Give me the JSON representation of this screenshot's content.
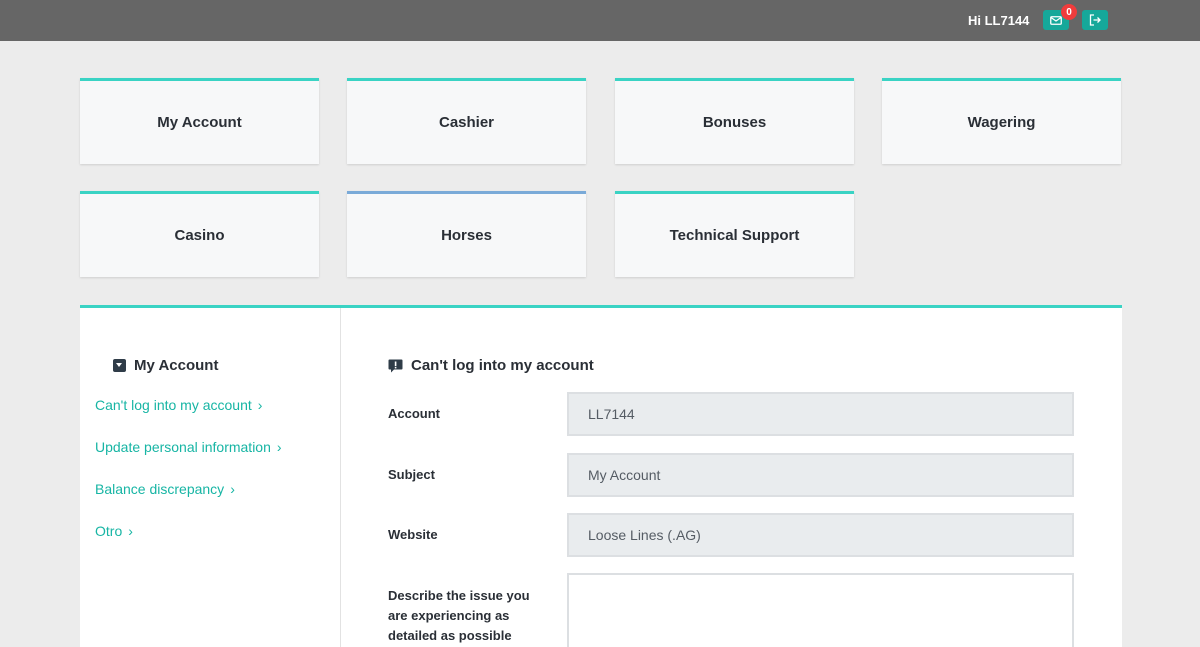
{
  "header": {
    "greeting": "Hi LL7144",
    "mail_badge": "0",
    "mail_icon": "mail-icon",
    "logout_icon": "logout-icon",
    "accent_color": "#16a89a"
  },
  "categories": [
    "My Account",
    "Cashier",
    "Bonuses",
    "Wagering",
    "Casino",
    "Horses",
    "Technical Support"
  ],
  "sidebar": {
    "title": "My Account",
    "links": [
      "Can't log into my account",
      "Update personal information",
      "Balance discrepancy",
      "Otro"
    ]
  },
  "form": {
    "title": "Can't log into my account",
    "account_label": "Account",
    "account_value": "LL7144",
    "subject_label": "Subject",
    "subject_value": "My Account",
    "website_label": "Website",
    "website_value": "Loose Lines (.AG)",
    "description_label": "Describe the issue you are experiencing as detailed as possible"
  },
  "colors": {
    "tile_border": "#3ad3c4",
    "tile_border_selected": "#7aaad8",
    "link": "#17b5a4"
  }
}
